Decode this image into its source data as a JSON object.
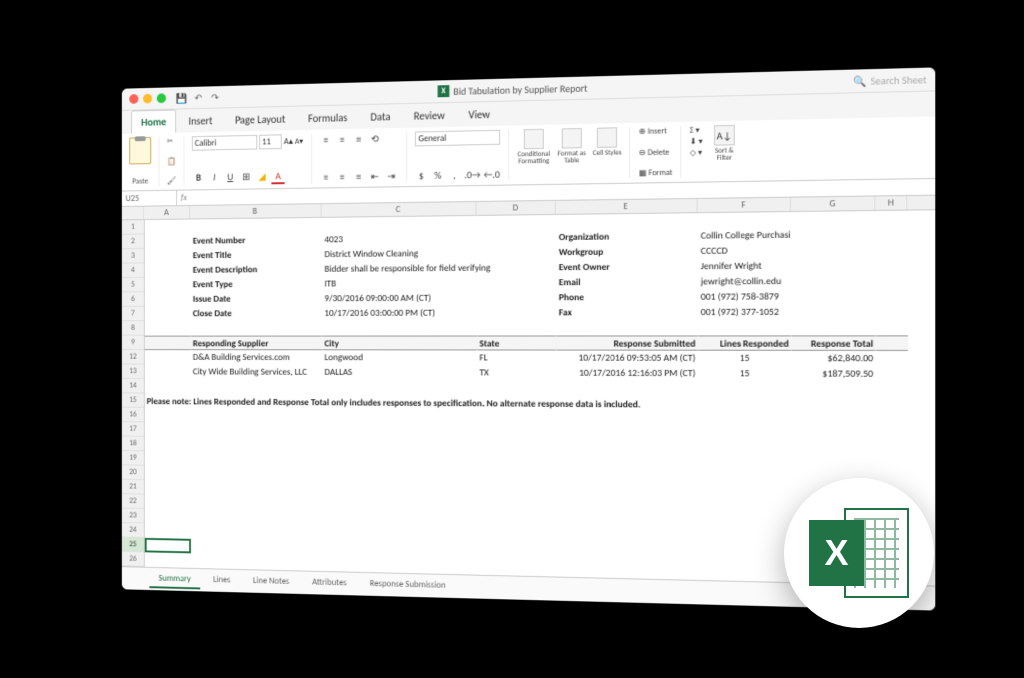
{
  "window": {
    "title": "Bid Tabulation by Supplier Report",
    "searchPlaceholder": "Search Sheet"
  },
  "ribbon": {
    "tabs": [
      "Home",
      "Insert",
      "Page Layout",
      "Formulas",
      "Data",
      "Review",
      "View"
    ],
    "activeTab": "Home",
    "paste": "Paste",
    "font": "Calibri",
    "fontSize": "11",
    "numberFormat": "General",
    "groups": {
      "conditional": "Conditional Formatting",
      "formatTable": "Format as Table",
      "cellStyles": "Cell Styles",
      "insert": "Insert",
      "delete": "Delete",
      "format": "Format",
      "sortFilter": "Sort & Filter"
    }
  },
  "cellRef": "U25",
  "columns": [
    "",
    "A",
    "B",
    "C",
    "D",
    "E",
    "F",
    "G",
    "H"
  ],
  "rows": [
    "1",
    "2",
    "3",
    "4",
    "5",
    "6",
    "7",
    "8",
    "9",
    "12",
    "13",
    "14",
    "15",
    "16",
    "17",
    "18",
    "19",
    "20",
    "21",
    "22",
    "23",
    "24",
    "25",
    "26"
  ],
  "meta": {
    "eventNumberLbl": "Event Number",
    "eventNumber": "4023",
    "eventTitleLbl": "Event Title",
    "eventTitle": "District Window Cleaning",
    "eventDescLbl": "Event Description",
    "eventDesc": "Bidder shall be responsible for field verifying",
    "eventTypeLbl": "Event Type",
    "eventType": "ITB",
    "issueDateLbl": "Issue Date",
    "issueDate": "9/30/2016 09:00:00 AM (CT)",
    "closeDateLbl": "Close Date",
    "closeDate": "10/17/2016 03:00:00 PM (CT)",
    "orgLbl": "Organization",
    "org": "Collin College Purchasing",
    "workgroupLbl": "Workgroup",
    "workgroup": "CCCCD",
    "ownerLbl": "Event Owner",
    "owner": "Jennifer Wright",
    "emailLbl": "Email",
    "email": "jewright@collin.edu",
    "phoneLbl": "Phone",
    "phone": "001 (972) 758-3879",
    "faxLbl": "Fax",
    "fax": "001 (972) 377-1052"
  },
  "tableHeaders": {
    "supplier": "Responding Supplier",
    "city": "City",
    "state": "State",
    "submitted": "Response Submitted",
    "lines": "Lines Responded",
    "total": "Response Total"
  },
  "tableRows": [
    {
      "supplier": "D&A Building Services.com",
      "city": "Longwood",
      "state": "FL",
      "submitted": "10/17/2016 09:53:05 AM (CT)",
      "lines": "15",
      "total": "$62,840.00"
    },
    {
      "supplier": "City Wide Building Services, LLC",
      "city": "DALLAS",
      "state": "TX",
      "submitted": "10/17/2016 12:16:03 PM (CT)",
      "lines": "15",
      "total": "$187,509.50"
    }
  ],
  "note": "Please note: Lines Responded and Response Total only includes responses to specification.  No alternate response data is included.",
  "sheetTabs": [
    "Summary",
    "Lines",
    "Line Notes",
    "Attributes",
    "Response Submission"
  ],
  "activeSheet": "Summary"
}
